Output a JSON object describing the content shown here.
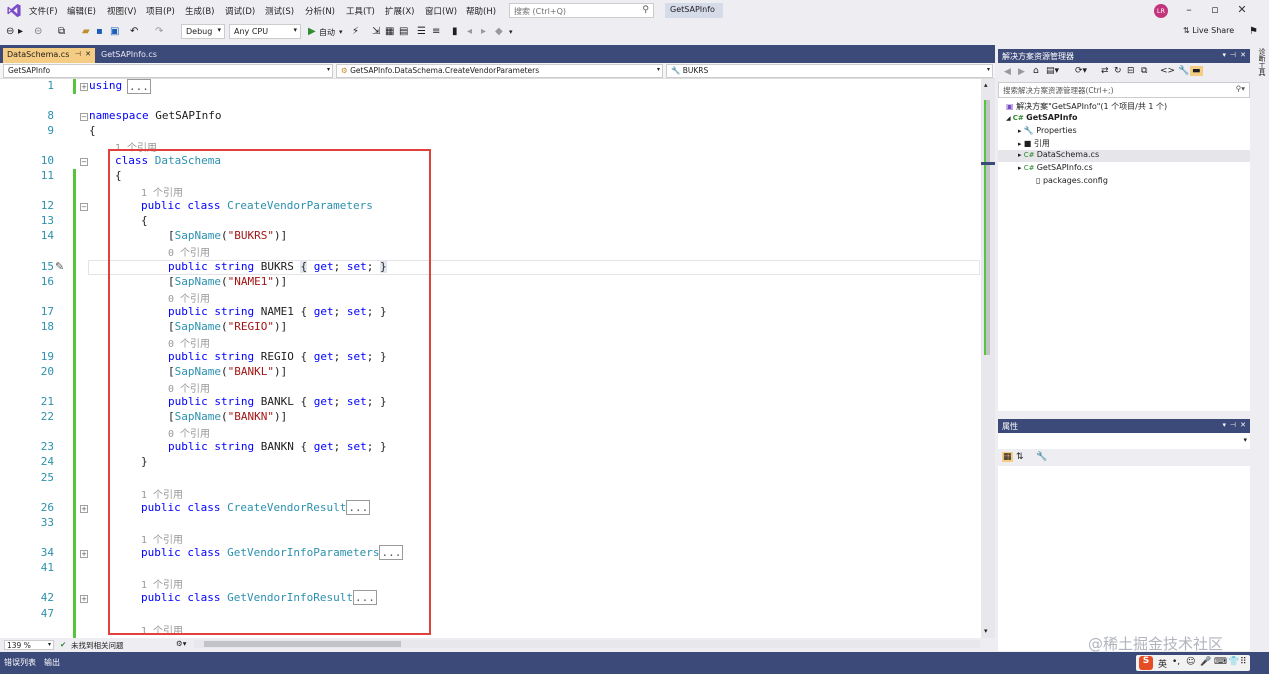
{
  "menu": {
    "items": [
      "文件(F)",
      "编辑(E)",
      "视图(V)",
      "项目(P)",
      "生成(B)",
      "调试(D)",
      "测试(S)",
      "分析(N)",
      "工具(T)",
      "扩展(X)",
      "窗口(W)",
      "帮助(H)"
    ],
    "search_placeholder": "搜索 (Ctrl+Q)",
    "solution_title": "GetSAPInfo",
    "avatar_initials": "LR",
    "live_share": "Live Share"
  },
  "toolbar": {
    "config": "Debug",
    "platform": "Any CPU",
    "run_label": "自动"
  },
  "tabs": [
    {
      "label": "DataSchema.cs",
      "active": true
    },
    {
      "label": "GetSAPInfo.cs",
      "active": false
    }
  ],
  "navbar": {
    "project": "GetSAPInfo",
    "type": "GetSAPInfo.DataSchema.CreateVendorParameters",
    "member": "BUKRS"
  },
  "code_lines": [
    {
      "n": "1",
      "text": "using "
    },
    {
      "n": "8",
      "text": "namespace GetSAPInfo"
    },
    {
      "n": "9",
      "text": "{"
    },
    {
      "n": "",
      "text": "1 个引用"
    },
    {
      "n": "10",
      "text": "class DataSchema"
    },
    {
      "n": "11",
      "text": "{"
    },
    {
      "n": "",
      "text": "1 个引用"
    },
    {
      "n": "12",
      "text": "public class CreateVendorParameters"
    },
    {
      "n": "13",
      "text": "{"
    },
    {
      "n": "14",
      "text": "[SapName(\"BUKRS\")]"
    },
    {
      "n": "",
      "text": "0 个引用"
    },
    {
      "n": "15",
      "text": "public string BUKRS { get; set; }"
    },
    {
      "n": "16",
      "text": "[SapName(\"NAME1\")]"
    },
    {
      "n": "",
      "text": "0 个引用"
    },
    {
      "n": "17",
      "text": "public string NAME1 { get; set; }"
    },
    {
      "n": "18",
      "text": "[SapName(\"REGIO\")]"
    },
    {
      "n": "",
      "text": "0 个引用"
    },
    {
      "n": "19",
      "text": "public string REGIO { get; set; }"
    },
    {
      "n": "20",
      "text": "[SapName(\"BANKL\")]"
    },
    {
      "n": "",
      "text": "0 个引用"
    },
    {
      "n": "21",
      "text": "public string BANKL { get; set; }"
    },
    {
      "n": "22",
      "text": "[SapName(\"BANKN\")]"
    },
    {
      "n": "",
      "text": "0 个引用"
    },
    {
      "n": "23",
      "text": "public string BANKN { get; set; }"
    },
    {
      "n": "24",
      "text": "}"
    },
    {
      "n": "25",
      "text": ""
    },
    {
      "n": "",
      "text": "1 个引用"
    },
    {
      "n": "26",
      "text": "public class CreateVendorResult"
    },
    {
      "n": "33",
      "text": ""
    },
    {
      "n": "",
      "text": "1 个引用"
    },
    {
      "n": "34",
      "text": "public class GetVendorInfoParameters"
    },
    {
      "n": "41",
      "text": ""
    },
    {
      "n": "",
      "text": "1 个引用"
    },
    {
      "n": "42",
      "text": "public class GetVendorInfoResult"
    },
    {
      "n": "47",
      "text": ""
    },
    {
      "n": "",
      "text": "1 个引用"
    }
  ],
  "collapsed_marker": "...",
  "status": {
    "zoom": "139 %",
    "issues": "未找到相关问题"
  },
  "solution_explorer": {
    "title": "解决方案资源管理器",
    "search_placeholder": "搜索解决方案资源管理器(Ctrl+;)",
    "solution": "解决方案\"GetSAPInfo\"(1 个项目/共 1 个)",
    "project": "GetSAPInfo",
    "items": [
      "Properties",
      "引用",
      "DataSchema.cs",
      "GetSAPInfo.cs",
      "packages.config"
    ]
  },
  "properties": {
    "title": "属性"
  },
  "side_tab": "诊断工具",
  "bottom_tabs": [
    "错误列表",
    "输出"
  ],
  "watermark": "@稀土掘金技术社区",
  "ime": {
    "logo": "S",
    "lang": "英"
  },
  "colors": {
    "accent": "#3c4a7a",
    "highlight_box": "#e0413b",
    "keyword": "#0000ff",
    "type": "#2b91af",
    "string": "#a31515",
    "change_bar": "#57c43e"
  }
}
